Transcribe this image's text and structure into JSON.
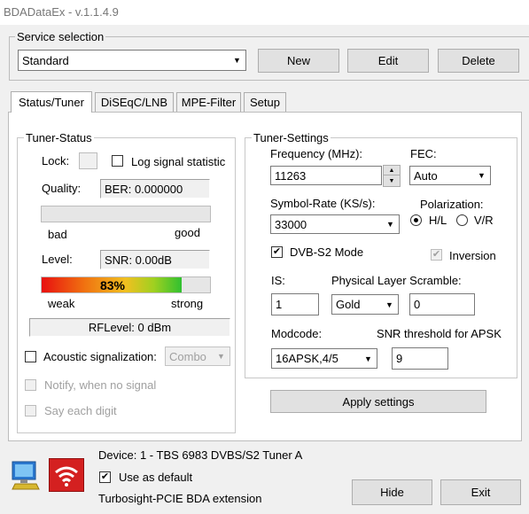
{
  "window": {
    "title": "BDADataEx - v.1.1.4.9"
  },
  "service": {
    "group_label": "Service selection",
    "selected": "Standard",
    "new_label": "New",
    "edit_label": "Edit",
    "delete_label": "Delete"
  },
  "tabs": [
    {
      "label": "Status/Tuner",
      "active": true
    },
    {
      "label": "DiSEqC/LNB",
      "active": false
    },
    {
      "label": "MPE-Filter",
      "active": false
    },
    {
      "label": "Setup",
      "active": false
    }
  ],
  "tuner_status": {
    "group_label": "Tuner-Status",
    "lock_label": "Lock:",
    "log_label": "Log signal statistic",
    "quality_label": "Quality:",
    "ber_value": "BER: 0.000000",
    "quality_fraction": 0,
    "bad_label": "bad",
    "good_label": "good",
    "level_label": "Level:",
    "snr_value": "SNR: 0.00dB",
    "level_percent_text": "83%",
    "level_fraction": 0.83,
    "weak_label": "weak",
    "strong_label": "strong",
    "rflevel_value": "RFLevel: 0 dBm",
    "acoustic_label": "Acoustic signalization:",
    "acoustic_combo": "Combo",
    "notify_label": "Notify, when no signal",
    "say_digit_label": "Say each digit"
  },
  "tuner_settings": {
    "group_label": "Tuner-Settings",
    "frequency_label": "Frequency (MHz):",
    "frequency_value": "11263",
    "fec_label": "FEC:",
    "fec_value": "Auto",
    "symbol_rate_label": "Symbol-Rate (KS/s):",
    "symbol_rate_value": "33000",
    "polarization_label": "Polarization:",
    "pol_hl_label": "H/L",
    "pol_vr_label": "V/R",
    "dvbs2_label": "DVB-S2 Mode",
    "inversion_label": "Inversion",
    "is_label": "IS:",
    "is_value": "1",
    "pls_label": "Physical Layer Scramble:",
    "pls_mode": "Gold",
    "pls_value": "0",
    "modcode_label": "Modcode:",
    "modcode_value": "16APSK,4/5",
    "snr_threshold_label": "SNR threshold for APSK",
    "snr_threshold_value": "9",
    "apply_label": "Apply settings"
  },
  "footer": {
    "device_text": "Device: 1 - TBS 6983 DVBS/S2 Tuner A",
    "use_default_label": "Use as default",
    "extension_text": "Turbosight-PCIE BDA extension",
    "hide_label": "Hide",
    "exit_label": "Exit"
  },
  "colors": {
    "accent": "#0078d7",
    "level_start": "#e81010",
    "level_mid": "#f0c020",
    "level_end": "#30c030",
    "wifi_red": "#d42020"
  }
}
